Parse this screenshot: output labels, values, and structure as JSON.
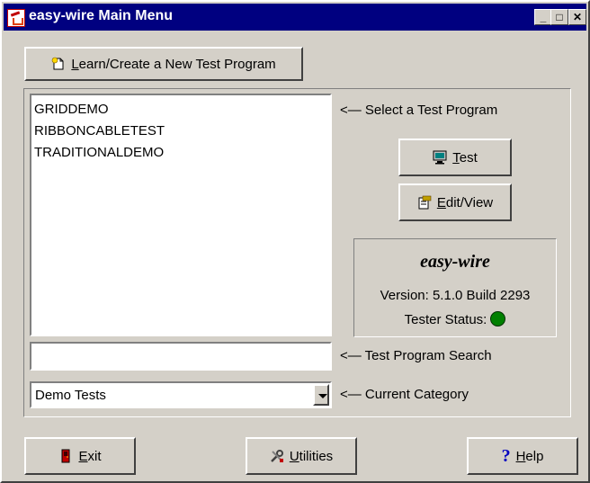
{
  "window": {
    "title": "easy-wire Main Menu",
    "controls": {
      "minimize": "_",
      "maximize": "□",
      "close": "✕"
    }
  },
  "toolbar": {
    "learn_create": {
      "label_mnemonic": "L",
      "label_rest": "earn/Create a New Test Program",
      "icon": "new-document-icon"
    }
  },
  "program_list": {
    "items": [
      "GRIDDEMO",
      "RIBBONCABLETEST",
      "TRADITIONALDEMO"
    ],
    "hint": "<— Select a Test Program"
  },
  "actions": {
    "test": {
      "label_mnemonic": "T",
      "label_rest": "est",
      "icon": "monitor-icon"
    },
    "edit_view": {
      "label_mnemonic": "E",
      "label_rest": "dit/View",
      "icon": "edit-document-icon"
    }
  },
  "info": {
    "title": "easy-wire",
    "version": "Version:  5.1.0 Build 2293",
    "tester_status_label": "Tester Status:",
    "tester_status_color": "#008000"
  },
  "search": {
    "value": "",
    "hint": "<— Test Program Search"
  },
  "category": {
    "selected": "Demo Tests",
    "hint": "<— Current Category"
  },
  "footer": {
    "exit": {
      "label_mnemonic": "E",
      "label_rest": "xit",
      "icon": "exit-door-icon"
    },
    "utilities": {
      "label_mnemonic": "U",
      "label_rest": "tilities",
      "icon": "tools-icon"
    },
    "help": {
      "label_mnemonic": "H",
      "label_rest": "elp",
      "icon": "question-mark-icon"
    }
  }
}
